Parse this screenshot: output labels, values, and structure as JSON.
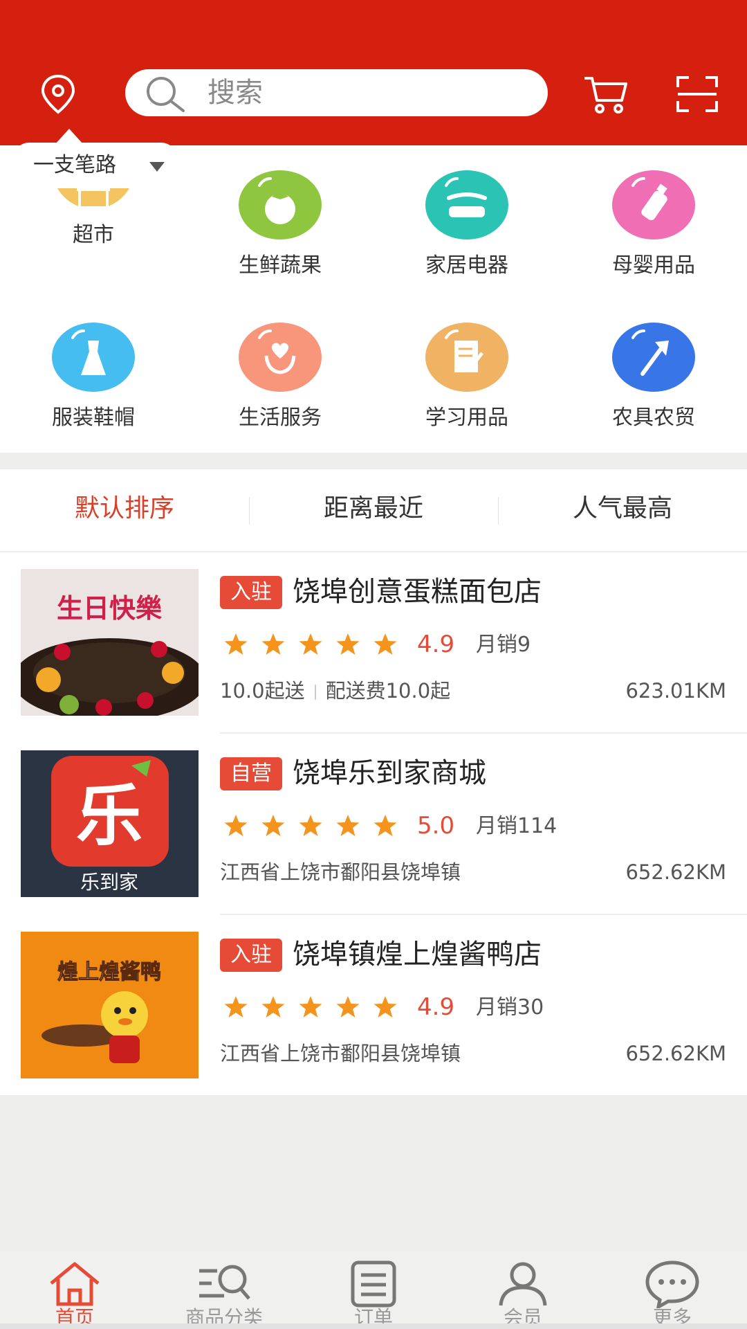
{
  "colors": {
    "brand": "#d5200f",
    "accent": "#e54b36",
    "star": "#f5941d"
  },
  "header": {
    "location_icon": "location-pin-icon",
    "search_placeholder": "搜索",
    "cart_icon": "cart-icon",
    "scan_icon": "scan-icon"
  },
  "location": {
    "label": "一支笔路"
  },
  "categories": [
    {
      "label": "超市",
      "icon": "supermarket-icon",
      "color": "#f3c45f"
    },
    {
      "label": "生鲜蔬果",
      "icon": "tomato-icon",
      "color": "#8ec63f"
    },
    {
      "label": "家居电器",
      "icon": "sofa-icon",
      "color": "#2bc4b4"
    },
    {
      "label": "母婴用品",
      "icon": "baby-bottle-icon",
      "color": "#f06fb4"
    },
    {
      "label": "服装鞋帽",
      "icon": "dress-icon",
      "color": "#45bdf0"
    },
    {
      "label": "生活服务",
      "icon": "heart-hands-icon",
      "color": "#f7967b"
    },
    {
      "label": "学习用品",
      "icon": "notebook-pen-icon",
      "color": "#f0b363"
    },
    {
      "label": "农具农贸",
      "icon": "axe-icon",
      "color": "#3876e8"
    }
  ],
  "sort": {
    "tabs": [
      "默认排序",
      "距离最近",
      "人气最高"
    ],
    "active_index": 0
  },
  "shops": [
    {
      "tag": "入驻",
      "name": "饶埠创意蛋糕面包店",
      "stars": 5,
      "rating": "4.9",
      "sales": "月销9",
      "info_parts": [
        "10.0起送",
        "配送费10.0起"
      ],
      "distance": "623.01KM",
      "image": "birthday-cake-image",
      "image_text": "生日快樂"
    },
    {
      "tag": "自营",
      "name": "饶埠乐到家商城",
      "stars": 5,
      "rating": "5.0",
      "sales": "月销114",
      "info_parts": [
        "江西省上饶市鄱阳县饶埠镇"
      ],
      "distance": "652.62KM",
      "image": "le-daojia-logo-image",
      "image_text": "乐到家"
    },
    {
      "tag": "入驻",
      "name": "饶埠镇煌上煌酱鸭店",
      "stars": 5,
      "rating": "4.9",
      "sales": "月销30",
      "info_parts": [
        "江西省上饶市鄱阳县饶埠镇"
      ],
      "distance": "652.62KM",
      "image": "duck-shop-logo-image",
      "image_text": "煌上煌酱鸭"
    }
  ],
  "tabbar": {
    "items": [
      {
        "label": "首页",
        "icon": "home-icon"
      },
      {
        "label": "商品分类",
        "icon": "category-search-icon"
      },
      {
        "label": "订单",
        "icon": "order-list-icon"
      },
      {
        "label": "会员",
        "icon": "member-icon"
      },
      {
        "label": "更多",
        "icon": "more-chat-icon"
      }
    ],
    "active_index": 0
  }
}
